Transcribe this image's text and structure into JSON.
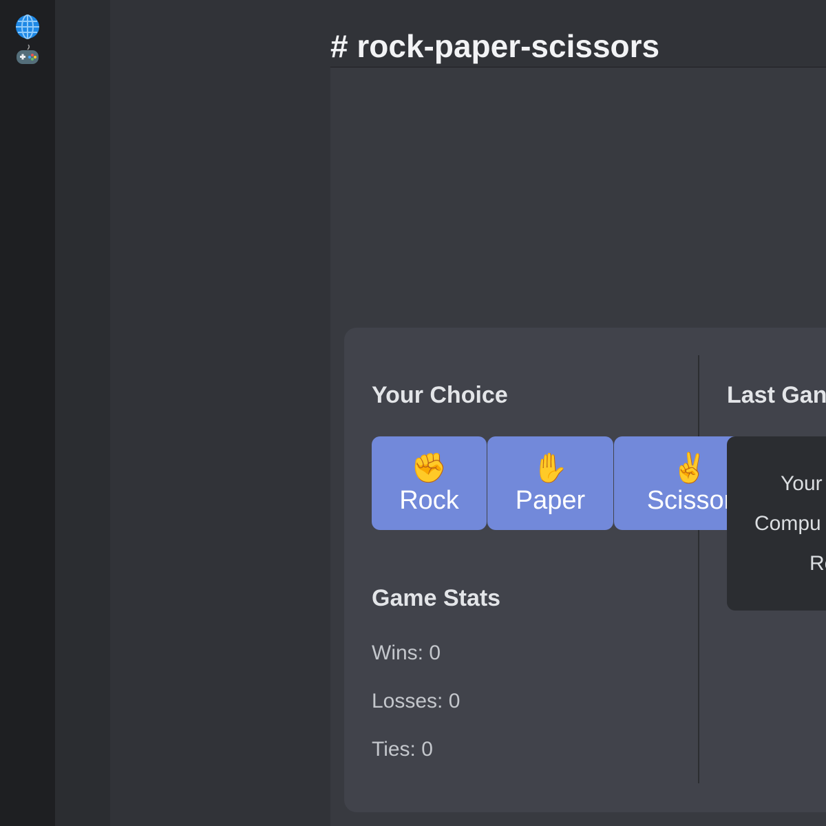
{
  "servers": [
    {
      "icon": "globe-icon",
      "glyph": "🌐"
    },
    {
      "icon": "game-controller-icon",
      "glyph": "🎮"
    }
  ],
  "channel": {
    "title": "# rock-paper-scissors"
  },
  "game": {
    "your_choice_title": "Your Choice",
    "last_game_title": "Last Gan",
    "choices": [
      {
        "emoji": "✊",
        "label": "Rock"
      },
      {
        "emoji": "✋",
        "label": "Paper"
      },
      {
        "emoji": "✌️",
        "label": "Scissor"
      }
    ],
    "last_game": {
      "you": "Your",
      "computer": "Compu",
      "result": "Re"
    },
    "stats": {
      "title": "Game Stats",
      "wins": "Wins: 0",
      "losses": "Losses: 0",
      "ties": "Ties: 0"
    }
  },
  "colors": {
    "accent": "#7289da",
    "background": "#313338",
    "card": "#41434b"
  }
}
